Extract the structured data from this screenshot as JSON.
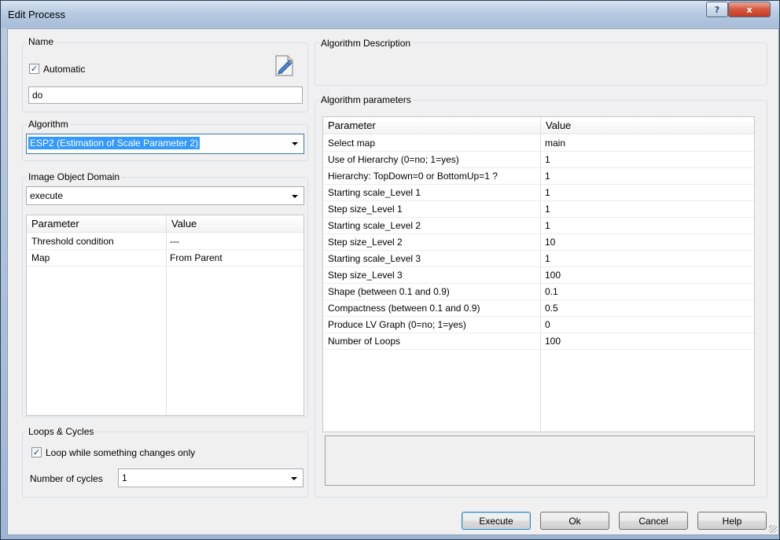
{
  "window": {
    "title": "Edit Process",
    "help_glyph": "?",
    "close_glyph": "x"
  },
  "name_group": {
    "label": "Name",
    "automatic_label": "Automatic",
    "automatic_checked": true,
    "name_value": "do",
    "edit_icon": "edit-name-icon"
  },
  "algorithm_group": {
    "label": "Algorithm",
    "selected": "ESP2 (Estimation of Scale Parameter 2)"
  },
  "domain_group": {
    "label": "Image Object Domain",
    "selected": "execute",
    "headers": {
      "parameter": "Parameter",
      "value": "Value"
    },
    "rows": [
      {
        "parameter": "Threshold condition",
        "value": "---"
      },
      {
        "parameter": "Map",
        "value": "From Parent"
      }
    ]
  },
  "loops_group": {
    "label": "Loops & Cycles",
    "loop_label": "Loop while something changes only",
    "loop_checked": true,
    "cycles_label": "Number of cycles",
    "cycles_value": "1"
  },
  "description_group": {
    "label": "Algorithm Description"
  },
  "parameters_group": {
    "label": "Algorithm parameters",
    "headers": {
      "parameter": "Parameter",
      "value": "Value"
    },
    "rows": [
      {
        "parameter": "Select map",
        "value": "main"
      },
      {
        "parameter": "Use of Hierarchy (0=no; 1=yes)",
        "value": "1"
      },
      {
        "parameter": "Hierarchy: TopDown=0 or BottomUp=1 ?",
        "value": "1"
      },
      {
        "parameter": "Starting scale_Level 1",
        "value": "1"
      },
      {
        "parameter": "Step size_Level 1",
        "value": "1"
      },
      {
        "parameter": "Starting scale_Level 2",
        "value": "1"
      },
      {
        "parameter": "Step size_Level 2",
        "value": "10"
      },
      {
        "parameter": "Starting scale_Level 3",
        "value": "1"
      },
      {
        "parameter": "Step size_Level 3",
        "value": "100"
      },
      {
        "parameter": "Shape (between 0.1 and 0.9)",
        "value": "0.1"
      },
      {
        "parameter": "Compactness (between 0.1 and 0.9)",
        "value": "0.5"
      },
      {
        "parameter": "Produce LV Graph (0=no; 1=yes)",
        "value": "0"
      },
      {
        "parameter": "Number of Loops",
        "value": "100"
      }
    ]
  },
  "buttons": {
    "execute": "Execute",
    "ok": "Ok",
    "cancel": "Cancel",
    "help": "Help"
  },
  "colors": {
    "selection": "#3399ff",
    "close_button": "#c7442a"
  }
}
